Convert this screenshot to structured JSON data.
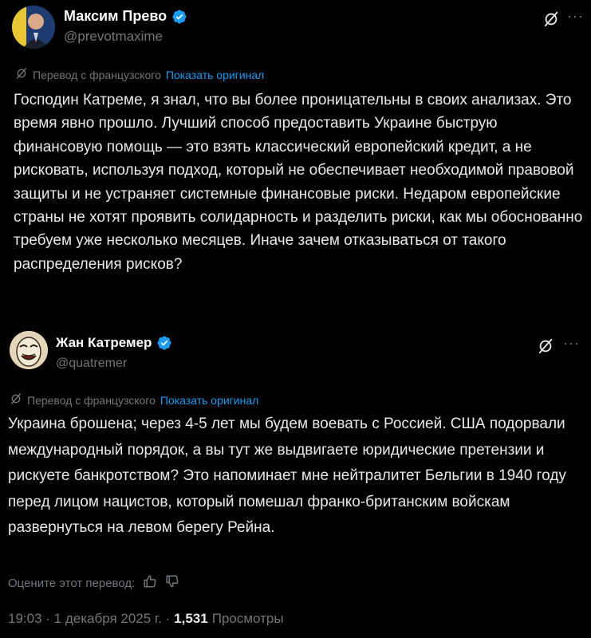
{
  "tweet": {
    "author_name": "Максим Прево",
    "author_handle": "@prevotmaxime",
    "translation_label": "Перевод с французского",
    "show_original_label": "Показать оригинал",
    "text": "Господин Катреме, я знал, что вы более проницательны в своих анализах. Это время явно прошло. Лучший способ предоставить Украине быструю финансовую помощь — это взять классический европейский кредит, а не рисковать, используя подход, который не обеспечивает необходимой правовой защиты и не устраняет системные финансовые риски. Недаром европейские страны не хотят проявить солидарность и разделить риски, как мы обоснованно требуем уже несколько месяцев. Иначе зачем отказываться от такого распределения рисков?"
  },
  "quoted_tweet": {
    "author_name": "Жан Катремер",
    "author_handle": "@quatremer",
    "translation_label": "Перевод с французского",
    "show_original_label": "Показать оригинал",
    "text": "Украина брошена; через 4-5 лет мы будем воевать с Россией. США подорвали международный порядок, а вы тут же выдвигаете юридические претензии и рискуете банкротством? Это напоминает мне нейтралитет Бельгии в 1940 году перед лицом нацистов, который помешал франко-британским войскам развернуться на левом берегу Рейна."
  },
  "rating": {
    "label": "Оцените этот перевод:"
  },
  "meta": {
    "time_date": "19:03 · 1 декабря 2025 г. ·",
    "views_count": "1,531",
    "views_label": "Просмотры"
  },
  "icons": {
    "verified": "verified-badge-icon",
    "grok": "grok-icon",
    "more": "more-icon",
    "translate": "translate-icon",
    "thumbs_up": "thumbs-up-icon",
    "thumbs_down": "thumbs-down-icon"
  },
  "colors": {
    "background": "#000000",
    "text": "#e7e9ea",
    "secondary": "#71767b",
    "link": "#1d9bf0",
    "verified": "#1d9bf0"
  }
}
